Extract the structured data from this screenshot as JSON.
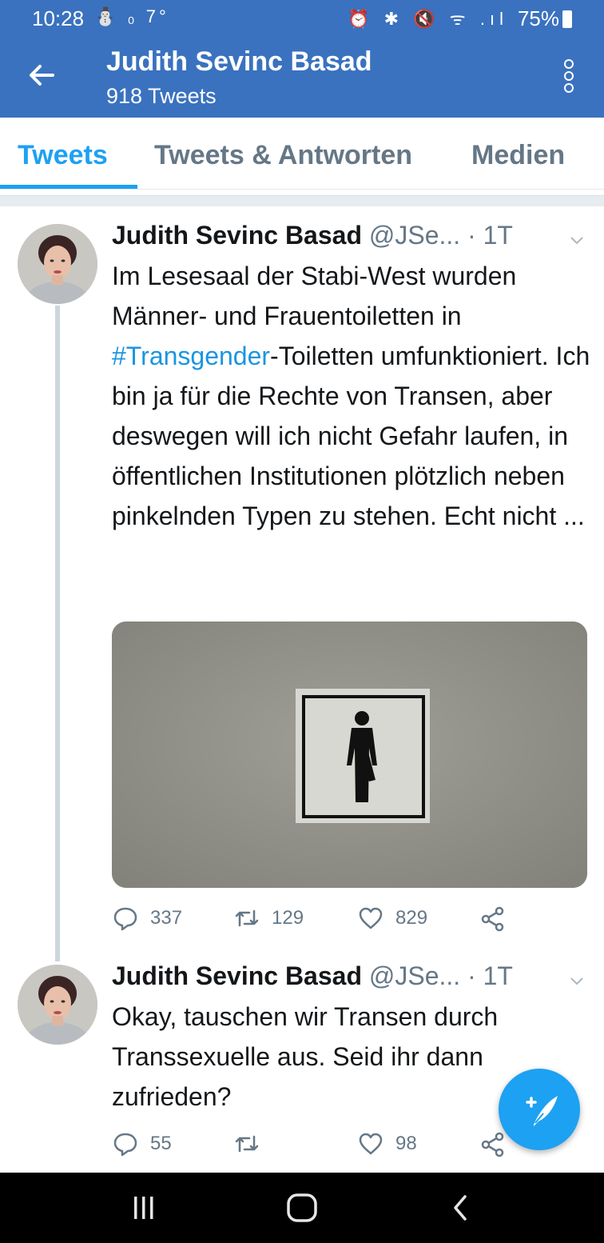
{
  "status_bar": {
    "time": "10:28",
    "left_indicators": "⛄ ₀ 7°",
    "right_indicators": "⏰ ✱ 🔇 ᯤ .ıl",
    "battery": "75%"
  },
  "header": {
    "title": "Judith Sevinc Basad",
    "subtitle": "918 Tweets"
  },
  "tabs": [
    {
      "label": "Tweets",
      "active": true
    },
    {
      "label": "Tweets & Antworten",
      "active": false
    },
    {
      "label": "Medien",
      "active": false
    }
  ],
  "tweets": [
    {
      "name": "Judith Sevinc Basad",
      "handle": "@JSe...",
      "time": "· 1T",
      "text_before": "Im Lesesaal der Stabi-West wurden Männer- und Frauentoiletten in ",
      "hashtag": "#Transgender",
      "text_after": "-Toiletten umfunktioniert. Ich bin ja für die Rechte von Transen, aber deswegen will ich nicht Gefahr laufen, in öffentlichen Institutionen plötzlich neben pinkelnden Typen zu stehen. Echt nicht ...",
      "replies": "337",
      "retweets": "129",
      "likes": "829"
    },
    {
      "name": "Judith Sevinc Basad",
      "handle": "@JSe...",
      "time": "· 1T",
      "text": "Okay, tauschen wir Transen durch Transsexuelle aus. Seid ihr dann zufrieden?",
      "replies": "55",
      "retweets": "",
      "likes": "98"
    }
  ],
  "colors": {
    "app_bar": "#3a72bf",
    "accent": "#1da1f2",
    "secondary_text": "#657786"
  },
  "icons": [
    "back-arrow-icon",
    "more-options-icon",
    "reply-icon",
    "retweet-icon",
    "like-icon",
    "share-icon",
    "compose-tweet-icon",
    "recents-icon",
    "home-icon",
    "nav-back-icon"
  ]
}
